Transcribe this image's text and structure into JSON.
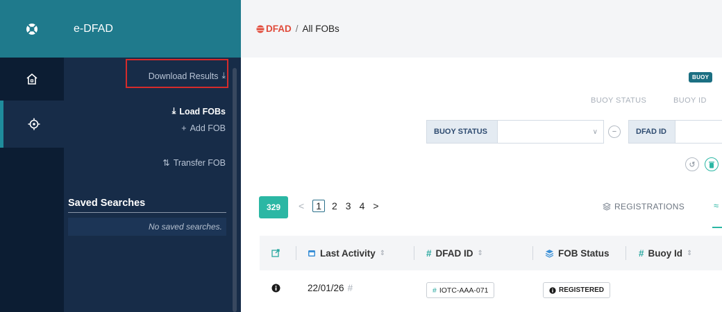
{
  "app": {
    "name": "e-DFAD"
  },
  "breadcrumb": {
    "brand": "DFAD",
    "separator": "/",
    "current": "All FOBs"
  },
  "sidebar": {
    "download_results": "Download Results",
    "load_fobs": "Load FOBs",
    "add_fob": "Add FOB",
    "transfer_fob": "Transfer FOB",
    "saved_searches_title": "Saved Searches",
    "saved_searches_empty": "No saved searches."
  },
  "columns_toolbar": {
    "badge": "BUOY",
    "labels": [
      "BUOY STATUS",
      "BUOY ID"
    ]
  },
  "filters": {
    "buoy_status_label": "BUOY STATUS",
    "buoy_status_value": "",
    "dfad_id_label": "DFAD ID",
    "dfad_id_value": ""
  },
  "results": {
    "count": "329",
    "pages": [
      "1",
      "2",
      "3",
      "4"
    ],
    "current_page": "1",
    "prev": "<",
    "next": ">",
    "tab_registrations": "REGISTRATIONS"
  },
  "table": {
    "headers": {
      "last_activity": "Last Activity",
      "dfad_id": "DFAD ID",
      "fob_status": "FOB Status",
      "buoy_id": "Buoy Id"
    },
    "rows": [
      {
        "last_activity": "22/01/26",
        "dfad_id": "IOTC-AAA-071",
        "fob_status": "REGISTERED"
      }
    ]
  },
  "colors": {
    "teal": "#1f7a8c",
    "navy": "#172c48",
    "accent": "#2bb7a4",
    "highlight": "#d62b2b"
  }
}
